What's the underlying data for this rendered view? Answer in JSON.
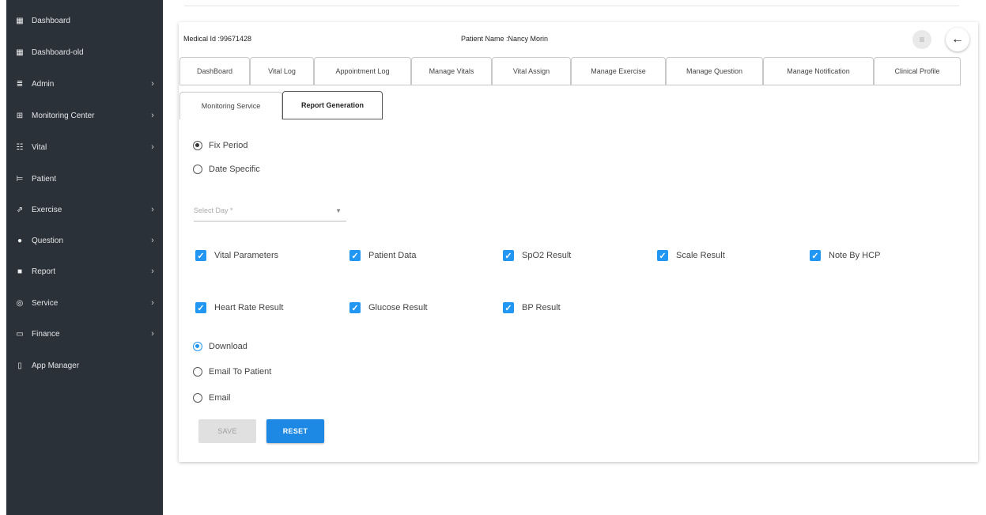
{
  "sidebar": {
    "items": [
      {
        "label": "Dashboard",
        "icon": "grid-icon",
        "glyph": "▦",
        "chevron": ""
      },
      {
        "label": "Dashboard-old",
        "icon": "grid-icon",
        "glyph": "▦",
        "chevron": ""
      },
      {
        "label": "Admin",
        "icon": "list-icon",
        "glyph": "≣",
        "chevron": "›"
      },
      {
        "label": "Monitoring Center",
        "icon": "hospital-icon",
        "glyph": "⊞",
        "chevron": "›"
      },
      {
        "label": "Vital",
        "icon": "people-icon",
        "glyph": "☷",
        "chevron": "›"
      },
      {
        "label": "Patient",
        "icon": "bed-icon",
        "glyph": "⊨",
        "chevron": ""
      },
      {
        "label": "Exercise",
        "icon": "run-icon",
        "glyph": "⇗",
        "chevron": "›"
      },
      {
        "label": "Question",
        "icon": "question-icon",
        "glyph": "●",
        "chevron": "›"
      },
      {
        "label": "Report",
        "icon": "report-icon",
        "glyph": "■",
        "chevron": "›"
      },
      {
        "label": "Service",
        "icon": "service-icon",
        "glyph": "◎",
        "chevron": "›"
      },
      {
        "label": "Finance",
        "icon": "money-icon",
        "glyph": "▭",
        "chevron": "›"
      },
      {
        "label": "App Manager",
        "icon": "phone-icon",
        "glyph": "▯",
        "chevron": ""
      }
    ]
  },
  "header": {
    "medical_id": "Medical Id :99671428",
    "patient_name": "Patient Name :Nancy Morin",
    "filter_glyph": "≡",
    "back_glyph": "←"
  },
  "tabs": {
    "row1": [
      "DashBoard",
      "Vital Log",
      "Appointment Log",
      "Manage Vitals",
      "Vital Assign",
      "Manage Exercise",
      "Manage Question",
      "Manage Notification",
      "Clinical Profile"
    ],
    "row2": [
      "Monitoring Service",
      "Report Generation"
    ],
    "active": "Report Generation"
  },
  "period": {
    "options": [
      "Fix Period",
      "Date Specific"
    ],
    "selected": "Fix Period"
  },
  "select_day": {
    "placeholder": "Select Day *",
    "arrow": "▼"
  },
  "parameters": {
    "checkmark": "✓",
    "items": [
      "Vital Parameters",
      "Patient Data",
      "SpO2 Result",
      "Scale Result",
      "Note By HCP",
      "Heart Rate Result",
      "Glucose Result",
      "BP Result"
    ],
    "checked": [
      true,
      true,
      true,
      true,
      true,
      true,
      true,
      true
    ]
  },
  "delivery": {
    "options": [
      "Download",
      "Email To Patient",
      "Email"
    ],
    "selected": "Download"
  },
  "buttons": {
    "save": "SAVE",
    "reset": "RESET"
  },
  "colors": {
    "accent": "#1e88e5",
    "sidebar": "#2b3139"
  }
}
